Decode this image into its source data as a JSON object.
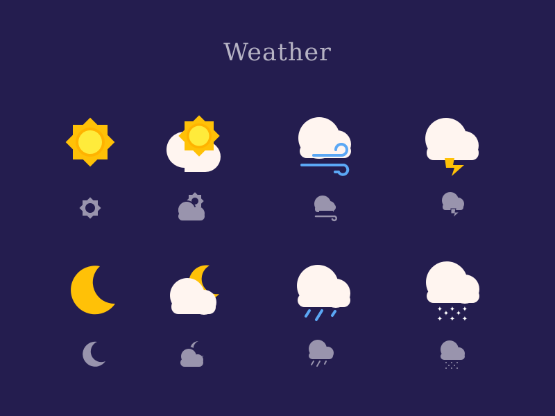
{
  "title": "Weather",
  "colors": {
    "background": "#241d4f",
    "sun": "#ffc107",
    "sun_outer": "#ffb300",
    "cloud": "#fff5f0",
    "wind_rain": "#5ba8f5",
    "lightning": "#ffc107",
    "snow": "#ffffff",
    "small_icon": "#9994ad"
  },
  "icons": [
    {
      "name": "sunny",
      "size": "large"
    },
    {
      "name": "partly-cloudy-day",
      "size": "large"
    },
    {
      "name": "windy",
      "size": "large"
    },
    {
      "name": "thunderstorm",
      "size": "large"
    },
    {
      "name": "sunny",
      "size": "small"
    },
    {
      "name": "partly-cloudy-day",
      "size": "small"
    },
    {
      "name": "windy",
      "size": "small"
    },
    {
      "name": "thunderstorm",
      "size": "small"
    },
    {
      "name": "clear-night",
      "size": "large"
    },
    {
      "name": "partly-cloudy-night",
      "size": "large"
    },
    {
      "name": "rain",
      "size": "large"
    },
    {
      "name": "snow",
      "size": "large"
    },
    {
      "name": "clear-night",
      "size": "small"
    },
    {
      "name": "partly-cloudy-night",
      "size": "small"
    },
    {
      "name": "rain",
      "size": "small"
    },
    {
      "name": "snow",
      "size": "small"
    }
  ]
}
